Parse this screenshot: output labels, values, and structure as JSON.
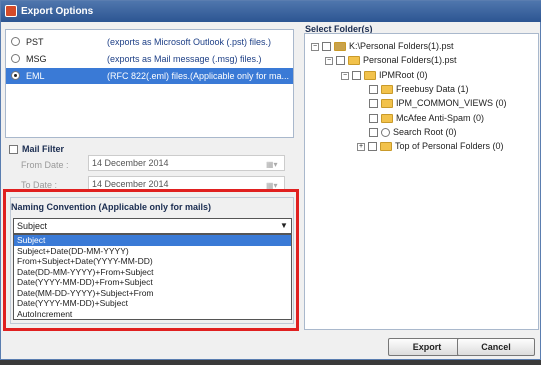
{
  "window": {
    "title": "Export Options"
  },
  "formats": [
    {
      "name": "PST",
      "desc": "(exports as Microsoft Outlook (.pst) files.)",
      "selected": false
    },
    {
      "name": "MSG",
      "desc": "(exports as Mail message (.msg) files.)",
      "selected": false
    },
    {
      "name": "EML",
      "desc": "(RFC 822(.eml) files.(Applicable only for ma...",
      "selected": true
    }
  ],
  "mail_filter": {
    "label": "Mail Filter",
    "from_label": "From Date :",
    "from_value": "14 December  2014",
    "to_label": "To Date :",
    "to_value": "14 December  2014"
  },
  "naming": {
    "title": "Naming Convention (Applicable only for mails)",
    "selected": "Subject",
    "options": [
      "Subject",
      "Subject+Date(DD-MM-YYYY)",
      "From+Subject+Date(YYYY-MM-DD)",
      "Date(DD-MM-YYYY)+From+Subject",
      "Date(YYYY-MM-DD)+From+Subject",
      "Date(MM-DD-YYYY)+Subject+From",
      "Date(YYYY-MM-DD)+Subject",
      "AutoIncrement"
    ]
  },
  "folders": {
    "label": "Select Folder(s)",
    "tree": [
      {
        "label": "K:\\Personal Folders(1).pst"
      },
      {
        "label": "Personal Folders(1).pst"
      },
      {
        "label": "IPMRoot (0)"
      },
      {
        "label": "Freebusy Data (1)"
      },
      {
        "label": "IPM_COMMON_VIEWS (0)"
      },
      {
        "label": "McAfee Anti-Spam (0)"
      },
      {
        "label": "Search Root (0)"
      },
      {
        "label": "Top of Personal Folders (0)"
      }
    ]
  },
  "buttons": {
    "export": "Export",
    "cancel": "Cancel"
  }
}
